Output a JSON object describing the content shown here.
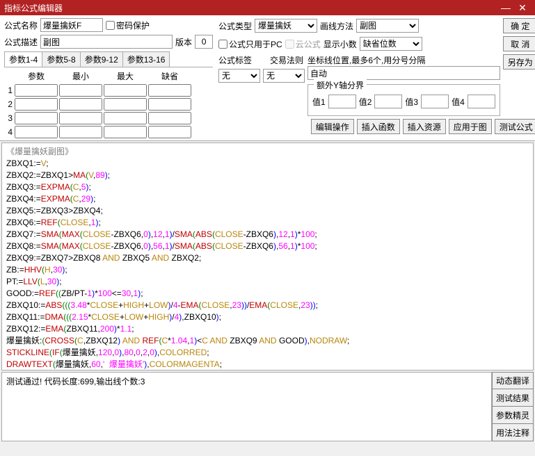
{
  "window": {
    "title": "指标公式编辑器",
    "min": "—",
    "close": "✕"
  },
  "labels": {
    "name": "公式名称",
    "pwd": "密码保护",
    "type": "公式类型",
    "drawmethod": "画线方法",
    "desc": "公式描述",
    "version": "版本",
    "onlypc": "公式只用于PC",
    "cloud": "云公式",
    "decimal": "显示小数",
    "tag": "公式标签",
    "rule": "交易法则",
    "coord": "坐标线位置,最多6个,用分号分隔",
    "extray": "额外Y轴分界",
    "v1": "值1",
    "v2": "值2",
    "v3": "值3",
    "v4": "值4"
  },
  "values": {
    "name": "爆量擒妖F",
    "type": "爆量擒妖",
    "drawmethod": "副图",
    "desc": "副图",
    "version": "0",
    "decimal": "缺省位数",
    "tag": "无",
    "rule": "无",
    "coord": "自动"
  },
  "buttons": {
    "ok": "确 定",
    "cancel": "取 消",
    "saveas": "另存为",
    "editop": "编辑操作",
    "insfn": "插入函数",
    "insres": "插入资源",
    "apply": "应用于图",
    "test": "测试公式",
    "dyntrans": "动态翻译",
    "testres": "测试结果",
    "paramwiz": "参数精灵",
    "usage": "用法注释"
  },
  "paramtabs": [
    "参数1-4",
    "参数5-8",
    "参数9-12",
    "参数13-16"
  ],
  "paramhead": [
    "参数",
    "最小",
    "最大",
    "缺省"
  ],
  "status": "测试通过! 代码长度:699,输出线个数:3",
  "chart_data": {
    "type": "code",
    "title": "《爆量擒妖副图》",
    "lines": [
      "ZBXQ1:=V;",
      "ZBXQ2:=ZBXQ1>MA(V,89);",
      "ZBXQ3:=EXPMA(C,5);",
      "ZBXQ4:=EXPMA(C,29);",
      "ZBXQ5:=ZBXQ3>ZBXQ4;",
      "ZBXQ6:=REF(CLOSE,1);",
      "ZBXQ7:=SMA(MAX(CLOSE-ZBXQ6,0),12,1)/SMA(ABS(CLOSE-ZBXQ6),12,1)*100;",
      "ZBXQ8:=SMA(MAX(CLOSE-ZBXQ6,0),56,1)/SMA(ABS(CLOSE-ZBXQ6),56,1)*100;",
      "ZBXQ9:=ZBXQ7>ZBXQ8 AND ZBXQ5 AND ZBXQ2;",
      "ZB:=HHV(H,30);",
      "PT:=LLV(L,30);",
      "GOOD:=REF((ZB/PT-1)*100<=30,1);",
      "ZBXQ10:=ABS(((3.48*CLOSE+HIGH+LOW)/4-EMA(CLOSE,23))/EMA(CLOSE,23));",
      "ZBXQ11:=DMA(((2.15*CLOSE+LOW+HIGH)/4),ZBXQ10);",
      "ZBXQ12:=EMA(ZBXQ11,200)*1.1;",
      "爆量擒妖:(CROSS(C,ZBXQ12) AND REF(C*1.04,1)<C AND ZBXQ9 AND GOOD),NODRAW;",
      "STICKLINE(IF(爆量擒妖,120,0),80,0,2,0),COLORRED;",
      "DRAWTEXT(爆量擒妖,60,'  爆量擒妖'),COLORMAGENTA;"
    ]
  }
}
